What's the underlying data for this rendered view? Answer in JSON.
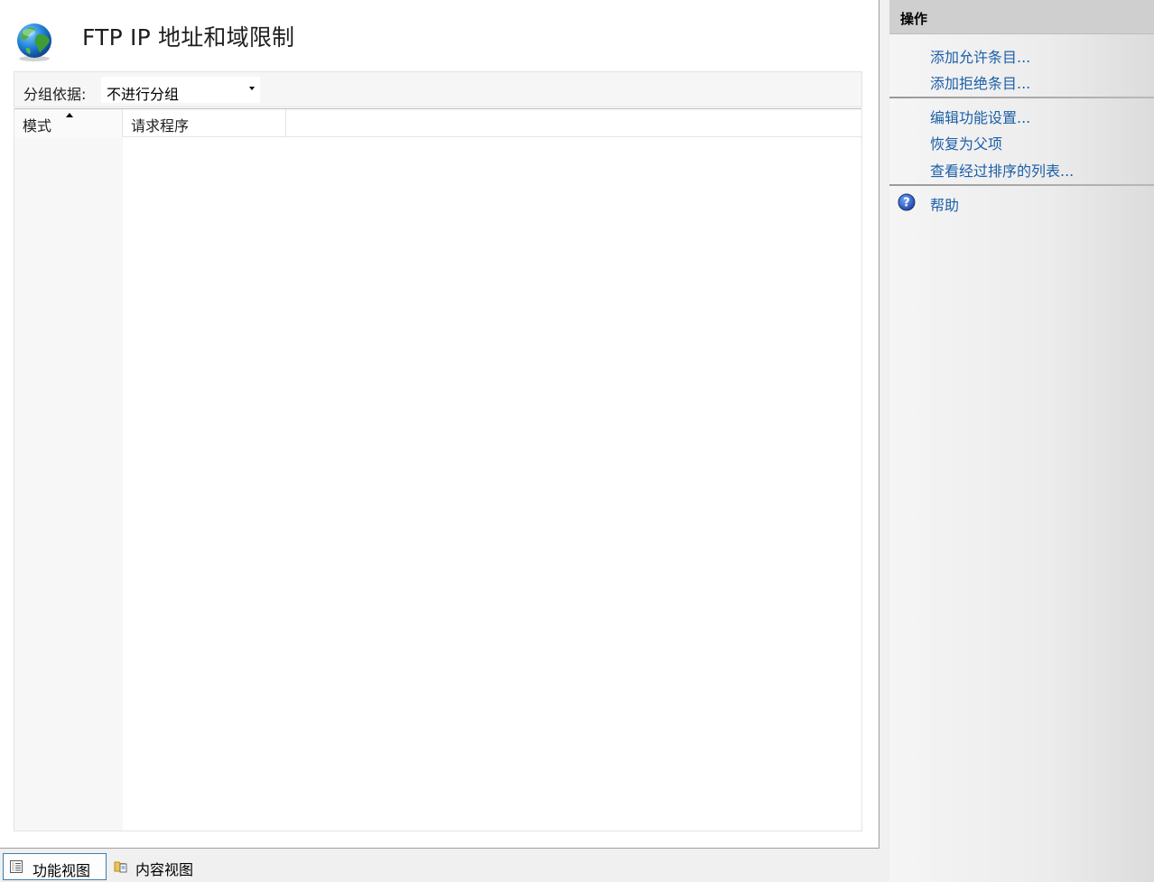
{
  "header": {
    "title": "FTP IP 地址和域限制",
    "icon": "globe-icon"
  },
  "group_bar": {
    "label": "分组依据:",
    "selected": "不进行分组"
  },
  "list": {
    "columns": [
      {
        "label": "模式",
        "sorted": "ascending"
      },
      {
        "label": "请求程序"
      }
    ],
    "rows": []
  },
  "view_tabs": {
    "features": "功能视图",
    "content": "内容视图"
  },
  "actions": {
    "title": "操作",
    "add_allow": "添加允许条目...",
    "add_deny": "添加拒绝条目...",
    "edit_settings": "编辑功能设置...",
    "revert": "恢复为父项",
    "view_sorted": "查看经过排序的列表...",
    "help": "帮助"
  },
  "colors": {
    "link": "#1c5fa8",
    "tab_selected_border": "#3c7fb1",
    "actions_header": "#cfcfcf"
  }
}
